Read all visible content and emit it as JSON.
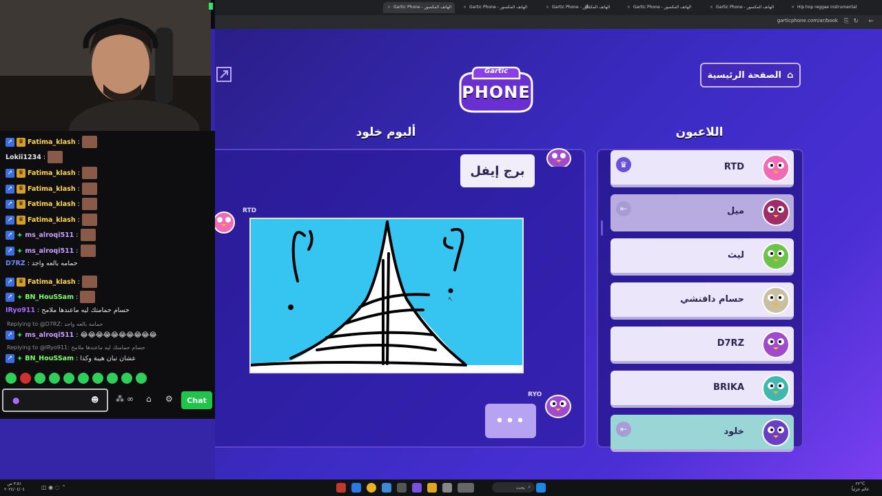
{
  "browser": {
    "tabs": [
      {
        "label": "Gartic Phone - الهاتف المكسور",
        "active": true
      },
      {
        "label": "Gartic Phone - الهاتف المكسور",
        "active": false
      },
      {
        "label": "Gartic Phone - الهاتف المكسور",
        "active": false
      },
      {
        "label": "Gartic Phone - الهاتف المكسور",
        "active": false
      },
      {
        "label": "Gartic Phone - الهاتف المكسور",
        "active": false
      },
      {
        "label": "Hip hop reggae instrumental",
        "active": false
      }
    ],
    "new_tab": "+",
    "url": "garticphone.com/ar/book"
  },
  "game": {
    "logo_top": "Gartic",
    "logo_bottom": "PHONE",
    "home_button": "الصفحة الرئيسية",
    "album_title": "ألبوم خلود",
    "players_title": "اللاعبون",
    "prompt_word": "برج إيفل",
    "drawing_author": "RTD",
    "next_author": "RYO",
    "typing_indicator": "•••",
    "players": [
      {
        "name": "RTD",
        "badge": "crown",
        "style": "normal",
        "avatar_color": "#f06ab8"
      },
      {
        "name": "ميل",
        "badge": "exit",
        "style": "dim",
        "avatar_color": "#a02c6a"
      },
      {
        "name": "ليث",
        "badge": "",
        "style": "normal",
        "avatar_color": "#6cc24a"
      },
      {
        "name": "حسام دافنشي",
        "badge": "",
        "style": "normal",
        "avatar_color": "#c8c0a0"
      },
      {
        "name": "D7RZ",
        "badge": "",
        "style": "normal",
        "avatar_color": "#a04ad0"
      },
      {
        "name": "BRIKA",
        "badge": "",
        "style": "normal",
        "avatar_color": "#3fb8b0"
      },
      {
        "name": "خلود",
        "badge": "exit",
        "style": "self",
        "avatar_color": "#6a3fc8"
      }
    ]
  },
  "chat": {
    "messages": [
      {
        "user": "Fatima_klash",
        "text": "",
        "color": "#ffd54a",
        "badges": [
          "blue",
          "gold"
        ],
        "emote": true
      },
      {
        "user": "Lokii1234",
        "text": "",
        "color": "#e8e8ea",
        "badges": [],
        "emote": true
      },
      {
        "user": "Fatima_klash",
        "text": "",
        "color": "#ffd54a",
        "badges": [
          "blue",
          "gold"
        ],
        "emote": true
      },
      {
        "user": "Fatima_klash",
        "text": "",
        "color": "#ffd54a",
        "badges": [
          "blue",
          "gold"
        ],
        "emote": true
      },
      {
        "user": "Fatima_klash",
        "text": "",
        "color": "#ffd54a",
        "badges": [
          "blue",
          "gold"
        ],
        "emote": true
      },
      {
        "user": "Fatima_klash",
        "text": "",
        "color": "#ffd54a",
        "badges": [
          "blue",
          "gold"
        ],
        "emote": true
      },
      {
        "user": "ms_alroqi511",
        "text": "",
        "color": "#c9a0ff",
        "badges": [
          "blue",
          "star"
        ],
        "emote": true
      },
      {
        "user": "ms_alroqi511",
        "text": "",
        "color": "#c9a0ff",
        "badges": [
          "blue",
          "star"
        ],
        "emote": true
      },
      {
        "user": "D7RZ",
        "text": "حمامه بالعه واجد",
        "color": "#6f8cff",
        "badges": [],
        "emote": false
      },
      {
        "user": "Fatima_klash",
        "text": "",
        "color": "#ffd54a",
        "badges": [
          "blue",
          "gold"
        ],
        "emote": true
      },
      {
        "user": "BN_HouSSam",
        "text": "",
        "color": "#7cff6b",
        "badges": [
          "blue",
          "star"
        ],
        "emote": true
      },
      {
        "user": "IRyo911",
        "text": "حسام حمامتك ليه ماعندها ملامح",
        "color": "#a86bff",
        "badges": [],
        "emote": false
      }
    ],
    "reply1": "Replying to @D7RZ: حمامه بالعه واجد",
    "reply1_msg": {
      "user": "ms_alroqi511",
      "text": "😂😂😂😂😂😂😂😂😂😂"
    },
    "reply2": "Replying to @IRyo911: حسام حمامتك ليه ماعندها ملامح",
    "reply2_msg": {
      "user": "BN_HouSSam",
      "text": "عشان تبان هيبة وكذا"
    },
    "send_label": "Chat"
  },
  "taskbar": {
    "time": "٣:٥١ ص",
    "date": "٢٠٢٤/٠٤/٠٤",
    "search": "بحث",
    "temp": "٢٢°C",
    "weather": "غائم جزئياً"
  }
}
